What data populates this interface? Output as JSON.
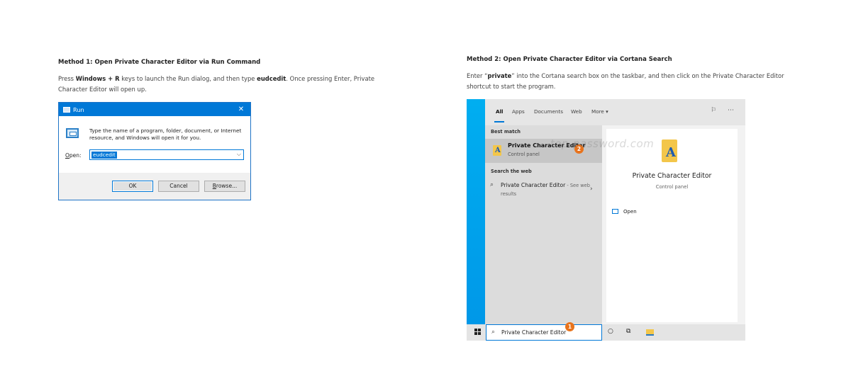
{
  "method1": {
    "heading": "Method 1: Open Private Character Editor via Run Command",
    "para": {
      "t1": "Press ",
      "k1": "Windows + R",
      "t2": " keys to launch the Run dialog, and then type ",
      "k2": "eudcedit",
      "t3": ". Once pressing Enter, Private Character Editor will open up."
    }
  },
  "run_dialog": {
    "title": "Run",
    "close": "✕",
    "description": "Type the name of a program, folder, document, or Internet resource, and Windows will open it for you.",
    "open_label_underlined": "O",
    "open_label_rest": "pen:",
    "input_value": "eudcedit",
    "dropdown_glyph": "⌵",
    "buttons": {
      "ok": "OK",
      "cancel": "Cancel",
      "browse_underlined": "B",
      "browse_rest": "rowse..."
    }
  },
  "method2": {
    "heading": "Method 2: Open Private Character Editor via Cortana Search",
    "para": {
      "t1": "Enter “",
      "k1": "private",
      "t2": "” into the Cortana search box on the taskbar, and then click on the Private Character Editor shortcut to start the program."
    }
  },
  "search": {
    "tabs": [
      "All",
      "Apps",
      "Documents",
      "Web",
      "More ▾"
    ],
    "best_match_label": "Best match",
    "best_match": {
      "title": "Private Character Editor",
      "subtitle": "Control panel",
      "step_badge": "2"
    },
    "web_label": "Search the web",
    "web_item": {
      "title": "Private Character Editor",
      "see": " - See web",
      "sub": "results"
    },
    "detail": {
      "title": "Private Character Editor",
      "subtitle": "Control panel",
      "open_label": "Open"
    },
    "watermark": "top-password.com",
    "query": "Private Character Editor",
    "query_badge": "1",
    "icons": {
      "feedback": "feedback-icon",
      "more": "more-icon",
      "search": "search-icon",
      "cortana": "cortana-icon",
      "taskview": "task-view-icon",
      "explorer": "file-explorer-icon"
    },
    "colors": {
      "accent": "#0078d7",
      "badge": "#e8731c",
      "folder": "#f3c64a"
    }
  }
}
